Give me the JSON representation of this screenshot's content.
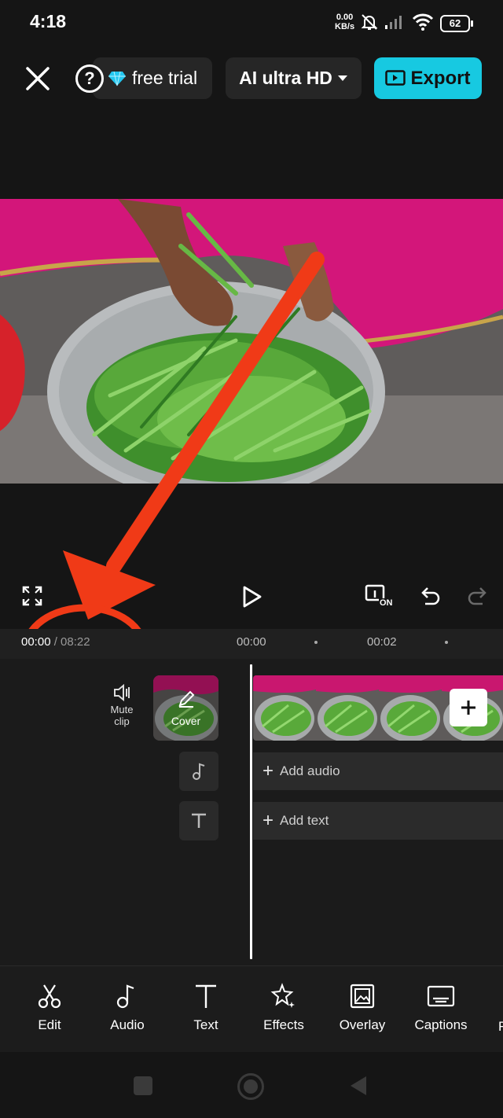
{
  "status_bar": {
    "time": "4:18",
    "net_speed_value": "0.00",
    "net_speed_unit": "KB/s",
    "battery": "62"
  },
  "top_bar": {
    "trial_label": "free trial",
    "quality_label": "AI ultra HD",
    "export_label": "Export",
    "help_label": "?"
  },
  "controls": {
    "fullscreen_icon": "expand-icon",
    "play_icon": "play-icon",
    "badge_label": "ON",
    "undo_icon": "undo-icon",
    "redo_icon": "redo-icon"
  },
  "ruler": {
    "current_time": "00:00",
    "duration": "/ 08:22",
    "ticks": [
      "00:00",
      "00:02"
    ]
  },
  "timeline": {
    "mute_label_1": "Mute",
    "mute_label_2": "clip",
    "cover_label": "Cover",
    "add_audio_label": "Add audio",
    "add_text_label": "Add text"
  },
  "toolbar": {
    "items": [
      {
        "label": "Edit",
        "icon": "scissors-icon"
      },
      {
        "label": "Audio",
        "icon": "music-note-icon"
      },
      {
        "label": "Text",
        "icon": "text-icon"
      },
      {
        "label": "Effects",
        "icon": "sparkle-star-icon"
      },
      {
        "label": "Overlay",
        "icon": "overlay-image-icon"
      },
      {
        "label": "Captions",
        "icon": "captions-icon"
      }
    ]
  },
  "annotation_color": "#f03a17",
  "accent_color": "#17c9e1"
}
